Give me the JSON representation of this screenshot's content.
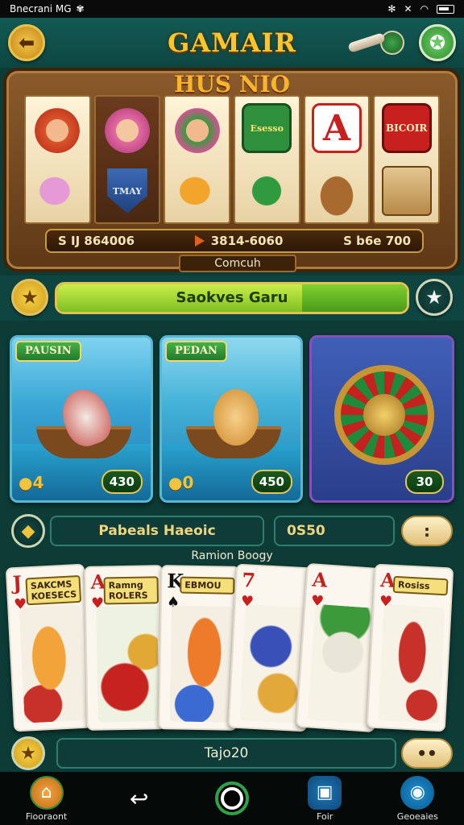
{
  "status_bar": {
    "carrier": "Bnecrani MG",
    "icons": [
      "bluetooth-icon",
      "mute-icon",
      "wifi-icon",
      "battery-icon"
    ]
  },
  "header": {
    "title": "GAMAIR",
    "back_icon": "back-arrow-icon",
    "star_icon": "star-icon"
  },
  "slot": {
    "title": "HUS NIO",
    "reel_symbols": [
      [
        "face",
        "fish-pink"
      ],
      [
        "face",
        "shield"
      ],
      [
        "face",
        "fish-gold"
      ],
      [
        "sign-green",
        "fish-green"
      ],
      [
        "card-a",
        "basket"
      ],
      [
        "sign-red",
        "drum"
      ]
    ],
    "symbol_texts": {
      "sign_green": "Esesso",
      "shield": "TMAY",
      "card_a": "A",
      "sign_red": "BICOIR"
    },
    "pay_left": "S IJ 864006",
    "pay_mid": "3814-6060",
    "pay_right": "S b6e 700",
    "label": "Comcuh"
  },
  "progress": {
    "label": "Saokves Garu",
    "fill": 0.7
  },
  "games": [
    {
      "tag": "PAUSIN",
      "score": "430",
      "coins": "4"
    },
    {
      "tag": "PEDAN",
      "score": "450",
      "coins": "0"
    },
    {
      "tag": "",
      "score": "30",
      "coins": ""
    }
  ],
  "paytable": {
    "label": "Pabeals Haeoic",
    "value": "0S50",
    "button": ":"
  },
  "section_caption": "Ramion Boogy",
  "play_cards": [
    {
      "rank": "J",
      "suit": "♥",
      "color": "red",
      "label": "SAKCMS KOESECS"
    },
    {
      "rank": "A",
      "suit": "♥",
      "color": "red",
      "label": "Ramng ROLERS"
    },
    {
      "rank": "K",
      "suit": "♠",
      "color": "blk",
      "label": "EBMOU"
    },
    {
      "rank": "7",
      "suit": "♥",
      "color": "red",
      "label": ""
    },
    {
      "rank": "A",
      "suit": "♥",
      "color": "red",
      "label": ""
    },
    {
      "rank": "A",
      "suit": "♥",
      "color": "red",
      "label": "Rosiss"
    }
  ],
  "bottom": {
    "label": "Tajo20",
    "button": "••"
  },
  "nav": [
    {
      "label": "Fiooraont",
      "icon": "home-icon"
    },
    {
      "label": "",
      "icon": "back-icon"
    },
    {
      "label": "",
      "icon": "home-circle-icon"
    },
    {
      "label": "Foir",
      "icon": "fair-icon"
    },
    {
      "label": "Geoeaies",
      "icon": "camera-icon"
    }
  ]
}
